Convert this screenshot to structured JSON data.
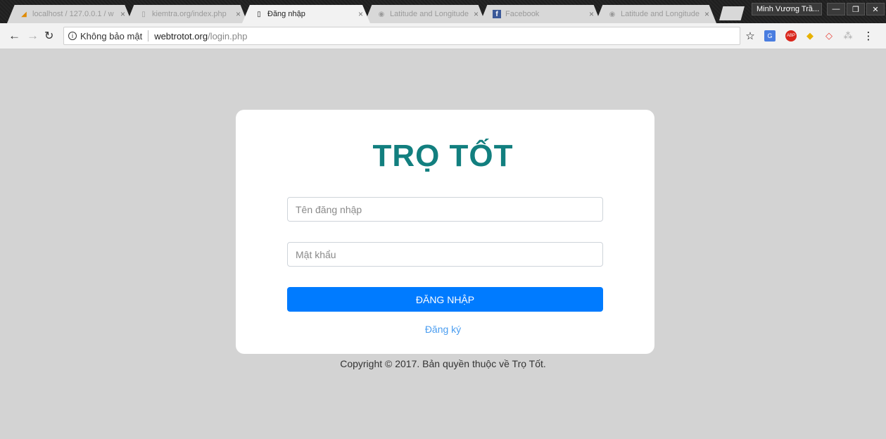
{
  "browser": {
    "tabs": [
      {
        "title": "localhost / 127.0.0.1 / w",
        "icon": "phpmyadmin-icon",
        "active": false
      },
      {
        "title": "kiemtra.org/index.php",
        "icon": "page-icon",
        "active": false
      },
      {
        "title": "Đăng nhập",
        "icon": "page-icon",
        "active": true
      },
      {
        "title": "Latitude and Longitude",
        "icon": "compass-icon",
        "active": false
      },
      {
        "title": "Facebook",
        "icon": "facebook-icon",
        "active": false
      },
      {
        "title": "Latitude and Longitude",
        "icon": "compass-icon",
        "active": false
      }
    ],
    "profile_name": "Minh Vương Trầ...",
    "security_label": "Không bảo mật",
    "url_host": "webtrotot.org",
    "url_path": "/login.php",
    "tab_close": "×"
  },
  "page": {
    "brand": "TRỌ TỐT",
    "username_placeholder": "Tên đăng nhập",
    "password_placeholder": "Mật khẩu",
    "login_button": "ĐĂNG NHẬP",
    "register_link": "Đăng ký",
    "copyright": "Copyright © 2017. Bản quyền thuộc về Trọ Tốt."
  },
  "colors": {
    "brand": "#127f7f",
    "primary": "#007bff",
    "link": "#4a9df0",
    "background": "#d3d3d3"
  }
}
